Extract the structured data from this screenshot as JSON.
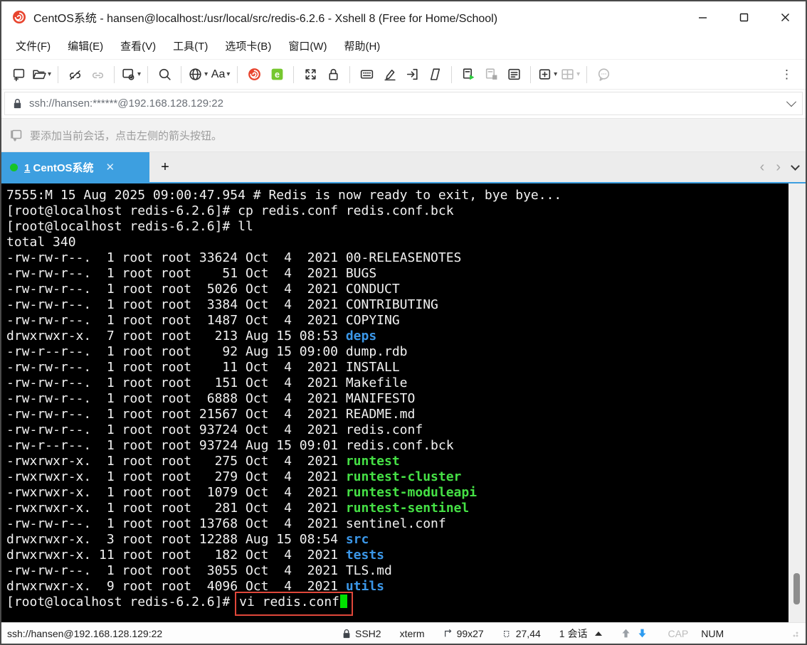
{
  "window": {
    "title": "CentOS系统 - hansen@localhost:/usr/local/src/redis-6.2.6 - Xshell 8 (Free for Home/School)"
  },
  "menu": {
    "items": [
      "文件(F)",
      "编辑(E)",
      "查看(V)",
      "工具(T)",
      "选项卡(B)",
      "窗口(W)",
      "帮助(H)"
    ]
  },
  "toolbar": {
    "font_label": "Aa",
    "xftp_letter": "e"
  },
  "address_bar": {
    "value": "ssh://hansen:******@192.168.128.129:22"
  },
  "info_bar": {
    "message": "要添加当前会话，点击左侧的箭头按钮。"
  },
  "tab_bar": {
    "active_tab": {
      "index": "1",
      "label": "CentOS系统"
    }
  },
  "terminal": {
    "lines": [
      [
        {
          "t": "7555:M 15 Aug 2025 09:00:47.954 # Redis is now ready to exit, bye bye..."
        }
      ],
      [
        {
          "t": "[root@localhost redis-6.2.6]# cp redis.conf redis.conf.bck"
        }
      ],
      [
        {
          "t": "[root@localhost redis-6.2.6]# ll"
        }
      ],
      [
        {
          "t": "total 340"
        }
      ],
      [
        {
          "t": "-rw-rw-r--.  1 root root 33624 Oct  4  2021 00-RELEASENOTES"
        }
      ],
      [
        {
          "t": "-rw-rw-r--.  1 root root    51 Oct  4  2021 BUGS"
        }
      ],
      [
        {
          "t": "-rw-rw-r--.  1 root root  5026 Oct  4  2021 CONDUCT"
        }
      ],
      [
        {
          "t": "-rw-rw-r--.  1 root root  3384 Oct  4  2021 CONTRIBUTING"
        }
      ],
      [
        {
          "t": "-rw-rw-r--.  1 root root  1487 Oct  4  2021 COPYING"
        }
      ],
      [
        {
          "t": "drwxrwxr-x.  7 root root   213 Aug 15 08:53 "
        },
        {
          "t": "deps",
          "c": "dir"
        }
      ],
      [
        {
          "t": "-rw-r--r--.  1 root root    92 Aug 15 09:00 dump.rdb"
        }
      ],
      [
        {
          "t": "-rw-rw-r--.  1 root root    11 Oct  4  2021 INSTALL"
        }
      ],
      [
        {
          "t": "-rw-rw-r--.  1 root root   151 Oct  4  2021 Makefile"
        }
      ],
      [
        {
          "t": "-rw-rw-r--.  1 root root  6888 Oct  4  2021 MANIFESTO"
        }
      ],
      [
        {
          "t": "-rw-rw-r--.  1 root root 21567 Oct  4  2021 README.md"
        }
      ],
      [
        {
          "t": "-rw-rw-r--.  1 root root 93724 Oct  4  2021 redis.conf"
        }
      ],
      [
        {
          "t": "-rw-r--r--.  1 root root 93724 Aug 15 09:01 redis.conf.bck"
        }
      ],
      [
        {
          "t": "-rwxrwxr-x.  1 root root   275 Oct  4  2021 "
        },
        {
          "t": "runtest",
          "c": "exec"
        }
      ],
      [
        {
          "t": "-rwxrwxr-x.  1 root root   279 Oct  4  2021 "
        },
        {
          "t": "runtest-cluster",
          "c": "exec"
        }
      ],
      [
        {
          "t": "-rwxrwxr-x.  1 root root  1079 Oct  4  2021 "
        },
        {
          "t": "runtest-moduleapi",
          "c": "exec"
        }
      ],
      [
        {
          "t": "-rwxrwxr-x.  1 root root   281 Oct  4  2021 "
        },
        {
          "t": "runtest-sentinel",
          "c": "exec"
        }
      ],
      [
        {
          "t": "-rw-rw-r--.  1 root root 13768 Oct  4  2021 sentinel.conf"
        }
      ],
      [
        {
          "t": "drwxrwxr-x.  3 root root 12288 Aug 15 08:54 "
        },
        {
          "t": "src",
          "c": "dir"
        }
      ],
      [
        {
          "t": "drwxrwxr-x. 11 root root   182 Oct  4  2021 "
        },
        {
          "t": "tests",
          "c": "dir"
        }
      ],
      [
        {
          "t": "-rw-rw-r--.  1 root root  3055 Oct  4  2021 TLS.md"
        }
      ],
      [
        {
          "t": "drwxrwxr-x.  9 root root  4096 Oct  4  2021 "
        },
        {
          "t": "utils",
          "c": "dir"
        }
      ],
      [
        {
          "t": "[root@localhost redis-6.2.6]# "
        },
        {
          "t": "vi redis.conf",
          "box": true,
          "cursor": true
        }
      ]
    ]
  },
  "status_bar": {
    "url": "ssh://hansen@192.168.128.129:22",
    "protocol": "SSH2",
    "terminal_type": "xterm",
    "screen_size": "99x27",
    "cursor_position": "27,44",
    "sessions": "1 会话",
    "caps_indicator": "CAP",
    "num_indicator": "NUM"
  },
  "colors": {
    "tab_accent": "#3d9fe0",
    "terminal_dir_blue": "#3b97e8",
    "terminal_exec_green": "#45e045",
    "terminal_cursor_green": "#00e100",
    "annotation_red": "#e0473a",
    "xshell_logo_red": "#e8442e",
    "xftp_logo_green": "#76c72f"
  }
}
